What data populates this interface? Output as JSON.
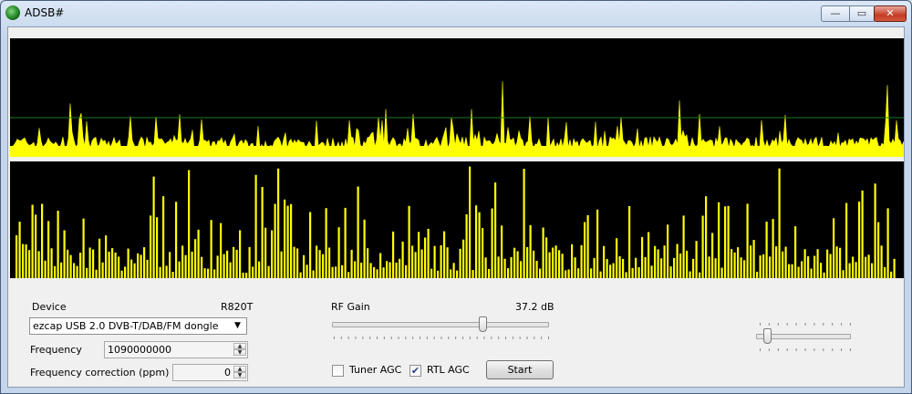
{
  "window": {
    "title": "ADSB#",
    "minimize_glyph": "—",
    "maximize_glyph": "▭",
    "close_glyph": "✕"
  },
  "device": {
    "label": "Device",
    "chip": "R820T",
    "selected": "ezcap USB 2.0 DVB-T/DAB/FM dongle"
  },
  "frequency": {
    "label": "Frequency",
    "value": "1090000000"
  },
  "correction": {
    "label": "Frequency correction (ppm)",
    "value": "0"
  },
  "rf_gain": {
    "label": "RF Gain",
    "value": "37.2 dB",
    "level": 0.7
  },
  "side_slider": {
    "level": 0.12
  },
  "tuner_agc": {
    "label": "Tuner AGC",
    "checked": false
  },
  "rtl_agc": {
    "label": "RTL AGC",
    "checked": true
  },
  "start": {
    "label": "Start"
  },
  "colors": {
    "signal": "#ffff00",
    "threshold": "#1f7a1f",
    "background": "#000000"
  }
}
